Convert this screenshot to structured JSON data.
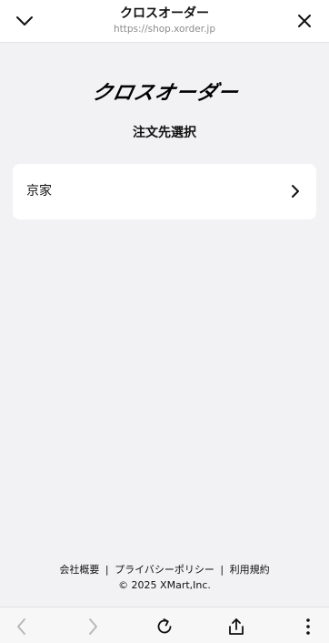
{
  "browser": {
    "title": "クロスオーダー",
    "url": "https://shop.xorder.jp"
  },
  "page": {
    "logo_text": "クロスオーダー",
    "heading": "注文先選択"
  },
  "stores": [
    {
      "name": "京家"
    }
  ],
  "footer": {
    "links": [
      "会社概要",
      "プライバシーポリシー",
      "利用規約"
    ],
    "separator": "|",
    "copyright": "© 2025 XMart,Inc."
  },
  "icons": {
    "collapse": "chevron-down-icon",
    "close": "close-icon",
    "store_arrow": "chevron-right-icon",
    "back": "back-arrow-icon",
    "forward": "forward-arrow-icon",
    "reload": "reload-icon",
    "share": "share-icon",
    "more": "more-vertical-icon"
  },
  "colors": {
    "background": "#f2f2f4",
    "card": "#ffffff",
    "text": "#111111",
    "url_text": "#8c8c8c",
    "disabled_icon": "#b5b5b8"
  }
}
